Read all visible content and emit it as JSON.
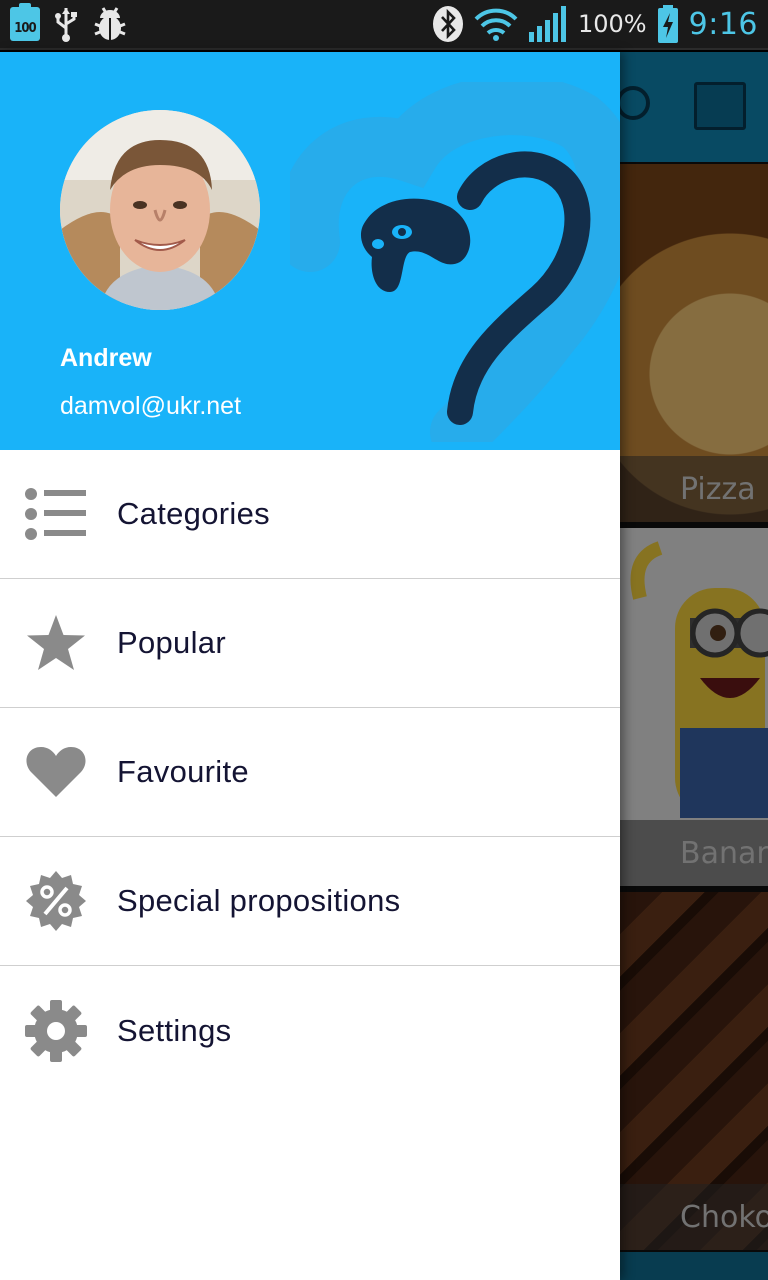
{
  "status_bar": {
    "battery_small_label": "100",
    "battery_percent": "100%",
    "time": "9:16",
    "icons": [
      "battery-100-icon",
      "usb-icon",
      "debug-bug-icon",
      "bluetooth-icon",
      "wifi-icon",
      "signal-icon",
      "battery-charging-icon"
    ]
  },
  "drawer": {
    "user": {
      "name": "Andrew",
      "email": "damvol@ukr.net"
    },
    "menu": [
      {
        "label": "Categories",
        "icon": "list-icon"
      },
      {
        "label": "Popular",
        "icon": "star-icon"
      },
      {
        "label": "Favourite",
        "icon": "heart-icon"
      },
      {
        "label": "Special propositions",
        "icon": "percent-badge-icon"
      },
      {
        "label": "Settings",
        "icon": "gear-icon"
      }
    ]
  },
  "background_app": {
    "tiles": [
      {
        "caption": "Pizza"
      },
      {
        "caption": "Banana"
      },
      {
        "caption": "Chokolate"
      }
    ]
  },
  "colors": {
    "header_blue": "#19b3f9",
    "toolbar_blue": "#0f88b5",
    "menu_text": "#141433",
    "icon_gray": "#8a8a8a",
    "status_accent": "#4dc6e6"
  }
}
